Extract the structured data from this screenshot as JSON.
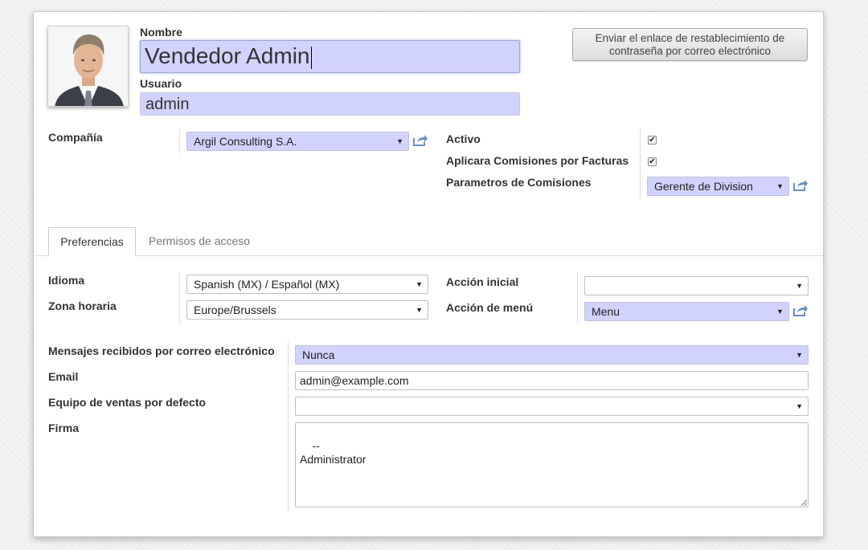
{
  "header": {
    "name_label": "Nombre",
    "name_value": "Vendedor Admin",
    "user_label": "Usuario",
    "user_value": "admin",
    "reset_button": "Enviar el enlace de restablecimiento de contraseña por correo electrónico"
  },
  "fields": {
    "company_label": "Compañía",
    "company_value": "Argil Consulting S.A.",
    "active_label": "Activo",
    "active_checked": true,
    "commissions_label": "Aplicara Comisiones por Facturas",
    "commissions_checked": true,
    "params_label": "Parametros de Comisiones",
    "params_value": "Gerente de Division"
  },
  "tabs": [
    {
      "label": "Preferencias",
      "active": true
    },
    {
      "label": "Permisos de acceso",
      "active": false
    }
  ],
  "preferences": {
    "language_label": "Idioma",
    "language_value": "Spanish (MX) / Español (MX)",
    "timezone_label": "Zona horaria",
    "timezone_value": "Europe/Brussels",
    "home_action_label": "Acción inicial",
    "home_action_value": "",
    "menu_action_label": "Acción de menú",
    "menu_action_value": "Menu",
    "email_notif_label": "Mensajes recibidos por correo electrónico",
    "email_notif_value": "Nunca",
    "email_label": "Email",
    "email_value": "admin@example.com",
    "sales_team_label": "Equipo de ventas por defecto",
    "sales_team_value": "",
    "signature_label": "Firma",
    "signature_value": "--\nAdministrator"
  },
  "icons": {
    "dropdown": "triangle-down-icon",
    "external": "external-link-icon",
    "check": "checkmark-icon"
  },
  "colors": {
    "required_field": "#d2d2ff"
  }
}
